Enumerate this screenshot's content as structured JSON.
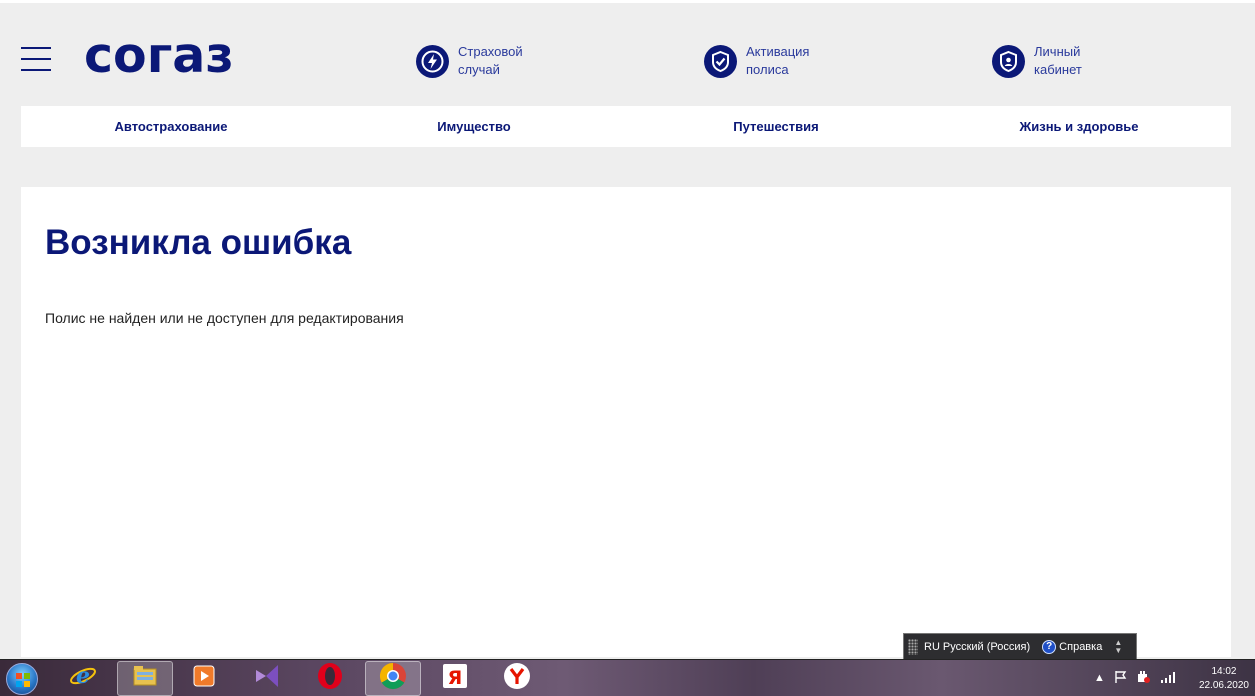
{
  "header": {
    "logo_text": "согаз",
    "links": [
      {
        "line1": "Страховой",
        "line2": "случай",
        "icon": "lightning-icon"
      },
      {
        "line1": "Активация",
        "line2": "полиса",
        "icon": "check-shield-icon"
      },
      {
        "line1": "Личный",
        "line2": "кабинет",
        "icon": "user-shield-icon"
      }
    ]
  },
  "nav": {
    "items": [
      "Автострахование",
      "Имущество",
      "Путешествия",
      "Жизнь и здоровье"
    ]
  },
  "content": {
    "title": "Возникла ошибка",
    "message": "Полис не найден или не доступен для редактирования"
  },
  "language_bar": {
    "code": "RU",
    "language": "Русский (Россия)",
    "help_label": "Справка"
  },
  "taskbar": {
    "time": "14:02",
    "date": "22.06.2020",
    "apps": [
      "internet-explorer-icon",
      "file-explorer-icon",
      "media-player-icon",
      "visual-studio-icon",
      "opera-icon",
      "chrome-icon",
      "yandex-icon",
      "yandex-browser-icon"
    ]
  },
  "colors": {
    "brand": "#0b1877",
    "background": "#eeeeee"
  }
}
